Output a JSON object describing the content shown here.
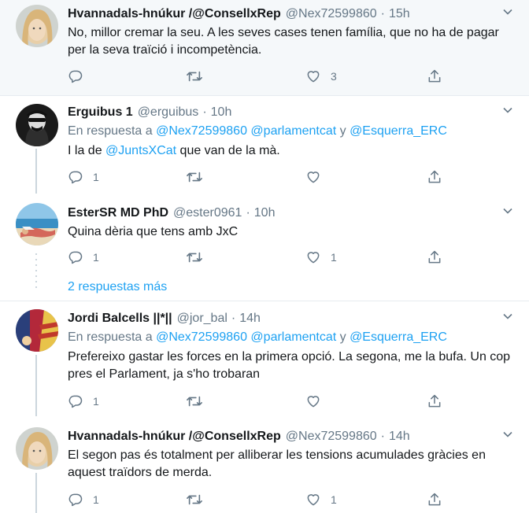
{
  "colors": {
    "link": "#1da1f2",
    "muted": "#657786",
    "text": "#14171a",
    "line": "#ccd6dd"
  },
  "tweets": [
    {
      "name": "Hvannadals-hnúkur /@ConsellxRep",
      "handle": "@Nex72599860",
      "time": "15h",
      "text": "No, millor cremar la seu. A les seves cases tenen família, que no ha de pagar per la seva traïció i incompetència.",
      "reply_count": "",
      "retweet_count": "",
      "like_count": "3"
    },
    {
      "name": "Erguibus 1",
      "handle": "@erguibus",
      "time": "10h",
      "reply_prefix": "En respuesta a",
      "reply_mention1": "@Nex72599860",
      "reply_mention2": "@parlamentcat",
      "reply_and": "y",
      "reply_mention3": "@Esquerra_ERC",
      "text_pre": "I la de ",
      "text_mention": "@JuntsXCat",
      "text_post": " que van de la mà.",
      "reply_count": "1",
      "retweet_count": "",
      "like_count": ""
    },
    {
      "name": "EsterSR MD PhD",
      "handle": "@ester0961",
      "time": "10h",
      "text": "Quina dèria que tens amb JxC",
      "reply_count": "1",
      "retweet_count": "",
      "like_count": "1"
    },
    {
      "name": "Jordi Balcells ||*||",
      "handle": "@jor_bal",
      "time": "14h",
      "reply_prefix": "En respuesta a",
      "reply_mention1": "@Nex72599860",
      "reply_mention2": "@parlamentcat",
      "reply_and": "y",
      "reply_mention3": "@Esquerra_ERC",
      "text": "Prefereixo gastar les forces en la primera opció.  La segona, me la bufa. Un cop pres el Parlament,  ja s'ho trobaran",
      "reply_count": "1",
      "retweet_count": "",
      "like_count": ""
    },
    {
      "name": "Hvannadals-hnúkur /@ConsellxRep",
      "handle": "@Nex72599860",
      "time": "14h",
      "text": "El segon pas és totalment per alliberar les tensions acumulades gràcies en aquest traïdors de merda.",
      "reply_count": "1",
      "retweet_count": "",
      "like_count": "1"
    }
  ],
  "more_replies": "2 respuestas más",
  "dot": "·"
}
